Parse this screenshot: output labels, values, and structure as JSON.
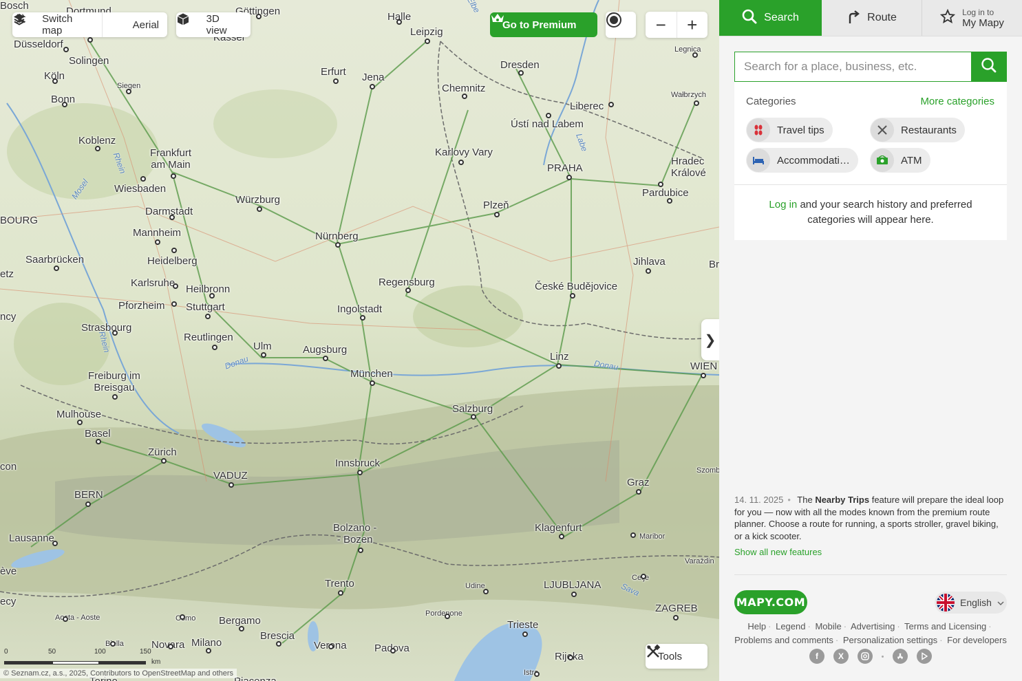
{
  "map": {
    "controls": {
      "switch_map": "Switch map",
      "aerial": "Aerial",
      "view3d": "3D view",
      "premium": "Go to Premium",
      "zoom_out": "−",
      "zoom_in": "+",
      "collapse": "❯",
      "tools": "Tools"
    },
    "cities": [
      {
        "name": "Göttingen"
      },
      {
        "name": "Halle"
      },
      {
        "name": "Leipzig"
      },
      {
        "name": "Düsseldorf"
      },
      {
        "name": "Solingen"
      },
      {
        "name": "Köln"
      },
      {
        "name": "Siegen"
      },
      {
        "name": "Bonn"
      },
      {
        "name": "Erfurt"
      },
      {
        "name": "Jena"
      },
      {
        "name": "Dresden"
      },
      {
        "name": "Chemnitz"
      },
      {
        "name": "Legnica"
      },
      {
        "name": "Wałbrzych"
      },
      {
        "name": "Liberec"
      },
      {
        "name": "Ústí nad Labem"
      },
      {
        "name": "Koblenz"
      },
      {
        "name": "Frankfurt am Main"
      },
      {
        "name": "Karlovy Vary"
      },
      {
        "name": "PRAHA"
      },
      {
        "name": "Hradec Králové"
      },
      {
        "name": "Wiesbaden"
      },
      {
        "name": "Würzburg"
      },
      {
        "name": "Darmstadt"
      },
      {
        "name": "Plzeň"
      },
      {
        "name": "Pardubice"
      },
      {
        "name": "Mannheim"
      },
      {
        "name": "Nürnberg"
      },
      {
        "name": "Saarbrücken"
      },
      {
        "name": "Heidelberg"
      },
      {
        "name": "Jihlava"
      },
      {
        "name": "Karlsruhe"
      },
      {
        "name": "Heilbronn"
      },
      {
        "name": "Regensburg"
      },
      {
        "name": "České Budějovice"
      },
      {
        "name": "Pforzheim"
      },
      {
        "name": "Stuttgart"
      },
      {
        "name": "Ingolstadt"
      },
      {
        "name": "Strasbourg"
      },
      {
        "name": "Reutlingen"
      },
      {
        "name": "Ulm"
      },
      {
        "name": "Augsburg"
      },
      {
        "name": "Linz"
      },
      {
        "name": "WIEN"
      },
      {
        "name": "Freiburg im Breisgau"
      },
      {
        "name": "München"
      },
      {
        "name": "Salzburg"
      },
      {
        "name": "Mulhouse"
      },
      {
        "name": "Basel"
      },
      {
        "name": "Zürich"
      },
      {
        "name": "Innsbruck"
      },
      {
        "name": "VADUZ"
      },
      {
        "name": "Graz"
      },
      {
        "name": "BERN"
      },
      {
        "name": "Lausanne"
      },
      {
        "name": "Bolzano - Bozen"
      },
      {
        "name": "Klagenfurt"
      },
      {
        "name": "Maribor"
      },
      {
        "name": "Trento"
      },
      {
        "name": "Udine"
      },
      {
        "name": "LJUBLJANA"
      },
      {
        "name": "Celje"
      },
      {
        "name": "ZAGREB"
      },
      {
        "name": "Bergamo"
      },
      {
        "name": "Brescia"
      },
      {
        "name": "Trieste"
      },
      {
        "name": "Novara"
      },
      {
        "name": "Milano"
      },
      {
        "name": "Verona"
      },
      {
        "name": "Padova"
      },
      {
        "name": "Rijeka"
      },
      {
        "name": "Pordenone"
      },
      {
        "name": "Como"
      },
      {
        "name": "Biella"
      },
      {
        "name": "Aosta - Aoste"
      },
      {
        "name": "Istra"
      }
    ],
    "partial_labels": [
      "Dortmund",
      "Kassel",
      "Bosch",
      "BOURG",
      "etz",
      "ncy",
      "con",
      "ève",
      "ecy",
      "Szomb",
      "Varaždin",
      "Brno",
      "Torino",
      "Piacenza"
    ],
    "rivers": [
      "Rhein",
      "Mosel",
      "Labe",
      "Donau",
      "Donau",
      "Rhein",
      "Sava",
      "Elbe"
    ],
    "scale": {
      "ticks": [
        "0",
        "50",
        "100",
        "150"
      ],
      "unit": "km"
    },
    "attribution": {
      "prefix": "© Seznam.cz, a.s., 2025, Contributors to",
      "link1": "OpenStreetMap",
      "and": "and",
      "link2": "others"
    }
  },
  "panel": {
    "tabs": [
      {
        "label": "Search"
      },
      {
        "label": "Route"
      },
      {
        "line1": "Log in to",
        "line2": "My Mapy"
      }
    ],
    "search": {
      "placeholder": "Search for a place, business, etc."
    },
    "categories": {
      "heading": "Categories",
      "more": "More categories",
      "items": [
        {
          "label": "Travel tips",
          "color": "#d9323a"
        },
        {
          "label": "Restaurants",
          "color": "#555555"
        },
        {
          "label": "Accommodati…",
          "color": "#2d63b3"
        },
        {
          "label": "ATM",
          "color": "#2aa12a"
        }
      ]
    },
    "login_message": {
      "link": "Log in",
      "text": "and your search history and preferred categories will appear here."
    },
    "news": {
      "date": "14. 11. 2025",
      "lead": "The",
      "bold": "Nearby Trips",
      "text": "feature will prepare the ideal loop for you — now with all the modes known from the premium route planner. Choose a route for running, a sports stroller, gravel biking, or a kick scooter.",
      "link": "Show all new features"
    },
    "logo": "MAPY.COM",
    "language": "English",
    "footer": {
      "links": [
        "Help",
        "Legend",
        "Mobile",
        "Advertising",
        "Terms and Licensing",
        "Problems and comments",
        "Personalization settings",
        "For developers"
      ]
    },
    "socials": [
      "facebook-icon",
      "x-icon",
      "instagram-icon",
      "app-store-icon",
      "google-play-icon"
    ],
    "accent_color": "#2aa12a"
  }
}
